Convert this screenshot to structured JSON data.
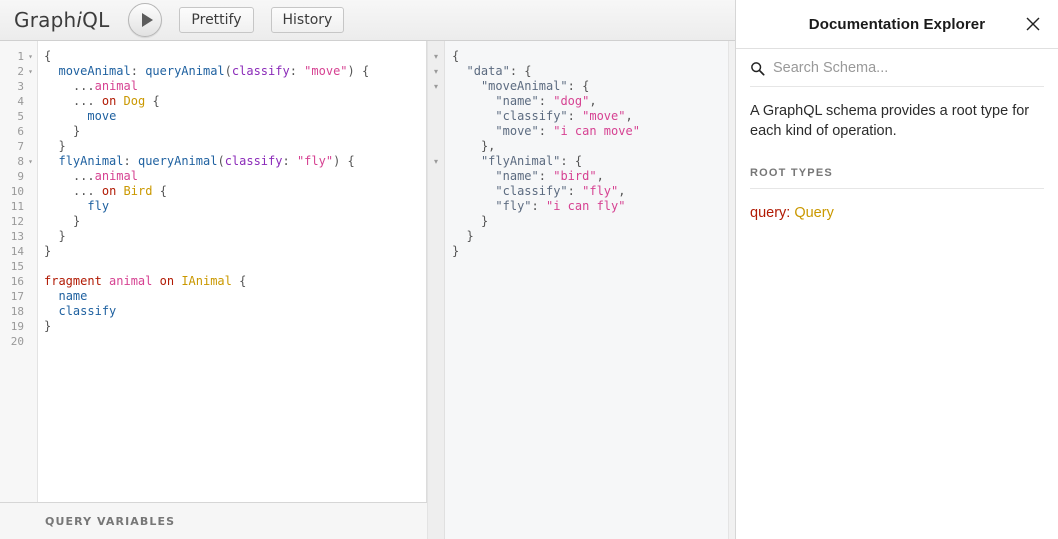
{
  "toolbar": {
    "logo_prefix": "Graph",
    "logo_em": "i",
    "logo_suffix": "QL",
    "execute_label": "▶",
    "prettify_label": "Prettify",
    "history_label": "History"
  },
  "query_editor": {
    "variables_label": "QUERY VARIABLES",
    "line_numbers": [
      1,
      2,
      3,
      4,
      5,
      6,
      7,
      8,
      9,
      10,
      11,
      12,
      13,
      14,
      15,
      16,
      17,
      18,
      19,
      20
    ],
    "fold_lines": [
      1,
      2,
      8
    ],
    "lines": [
      "{",
      "  moveAnimal: queryAnimal(classify: \"move\") {",
      "    ...animal",
      "    ... on Dog {",
      "      move",
      "    }",
      "  }",
      "  flyAnimal: queryAnimal(classify: \"fly\") {",
      "    ...animal",
      "    ... on Bird {",
      "      fly",
      "    }",
      "  }",
      "}",
      "",
      "fragment animal on IAnimal {",
      "  name",
      "  classify",
      "}",
      ""
    ]
  },
  "result": {
    "fold_markers": 4,
    "lines": [
      "{",
      "  \"data\": {",
      "    \"moveAnimal\": {",
      "      \"name\": \"dog\",",
      "      \"classify\": \"move\",",
      "      \"move\": \"i can move\"",
      "    },",
      "    \"flyAnimal\": {",
      "      \"name\": \"bird\",",
      "      \"classify\": \"fly\",",
      "      \"fly\": \"i can fly\"",
      "    }",
      "  }",
      "}"
    ],
    "data": {
      "data": {
        "moveAnimal": {
          "name": "dog",
          "classify": "move",
          "move": "i can move"
        },
        "flyAnimal": {
          "name": "bird",
          "classify": "fly",
          "fly": "i can fly"
        }
      }
    }
  },
  "doc_explorer": {
    "title": "Documentation Explorer",
    "close_icon": "close-icon",
    "search_icon": "search-icon",
    "search_value": "",
    "search_placeholder": "Search Schema...",
    "description": "A GraphQL schema provides a root type for each kind of operation.",
    "section_title": "ROOT TYPES",
    "root_types": [
      {
        "key": "query:",
        "value": "Query"
      }
    ]
  },
  "colors": {
    "accent_string": "#d64292",
    "accent_keyword": "#b11a04",
    "accent_type": "#ca9800",
    "accent_field": "#1f61a0",
    "accent_arg": "#8b2bb9",
    "result_bg": "#f6f7f8",
    "toolbar_bg": "#ececec"
  }
}
